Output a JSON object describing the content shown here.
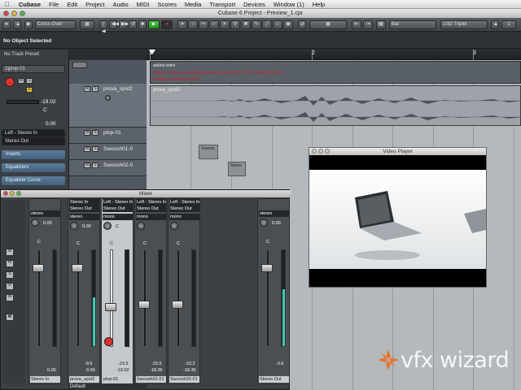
{
  "menubar": {
    "app": "Cubase",
    "items": [
      "File",
      "Edit",
      "Project",
      "Audio",
      "MIDI",
      "Scores",
      "Media",
      "Transport",
      "Devices",
      "Window (1)",
      "Help"
    ]
  },
  "window": {
    "title": "Cubase 6 Project - Preview_1.cpr"
  },
  "toolbar": {
    "crossover": "Cross-Over",
    "grid_type": "Bar",
    "quantize": "1/32 Triplet",
    "counter": "1"
  },
  "infoline": {
    "status": "No Object Selected"
  },
  "inspector": {
    "preset": "No Track Preset",
    "track": "2|plop-01",
    "value": "-19.02",
    "pan": "C",
    "value2": "0.00",
    "routing_in": "Left - Stereo In",
    "routing_out": "Stereo Out",
    "sections": [
      "Inserts",
      "Equalizers",
      "Equalizer Curve"
    ]
  },
  "tracks": [
    {
      "name": "prova_spot2"
    },
    {
      "name": "plop-01"
    },
    {
      "name": "Swoosh01-0"
    },
    {
      "name": "Swoosh02-0"
    }
  ],
  "ruler": {
    "marks": [
      "1",
      "2",
      "3"
    ]
  },
  "project": {
    "event_top": "aelink-intro",
    "warning_lines": [
      "Project - Video frame Rate Mismatch. Project 23.97 fps, Video 29.97 fps",
      "Missing Thumbnail Cache"
    ],
    "audio_event": "prova_spot2",
    "event_swoosh1": "Swoos",
    "event_swoosh2": "Swoo"
  },
  "mixer": {
    "title": "Mixer",
    "strips": [
      {
        "in": "",
        "out": "",
        "mode": "stereo",
        "pan": "C",
        "vol": "0.00",
        "peak": "",
        "name": "Stereo In"
      },
      {
        "in": "Stereo In",
        "out": "Stereo Out",
        "mode": "stereo",
        "pan": "C",
        "vol": "0.00",
        "peak": "-9.5",
        "name": "prova_spot2"
      },
      {
        "in": "Left - Stereo In",
        "out": "Stereo Out",
        "mode": "mono",
        "pan": "C",
        "vol": "-19.02",
        "peak": "-23.5",
        "name": "plop-01"
      },
      {
        "in": "Left - Stereo In",
        "out": "Stereo Out",
        "mode": "mono",
        "pan": "C",
        "vol": "-18.35",
        "peak": "-23.5",
        "name": "Swoosh01-01"
      },
      {
        "in": "Left - Stereo In",
        "out": "Stereo Out",
        "mode": "mono",
        "pan": "C",
        "vol": "-18.35",
        "peak": "-23.2",
        "name": "Swoosh02-01"
      },
      {
        "in": "",
        "out": "",
        "mode": "stereo",
        "pan": "C",
        "vol": "0.00",
        "peak": "-2.6",
        "name": "Stereo Out"
      }
    ],
    "footer": "Default"
  },
  "video_player": {
    "title": "Video Player"
  },
  "watermark": {
    "text": "vfx wizard"
  },
  "colors": {
    "accent_blue": "#4a7aa0",
    "play_green": "#2fbf2f",
    "record_red": "#e03030",
    "warning_red": "#d02020"
  }
}
